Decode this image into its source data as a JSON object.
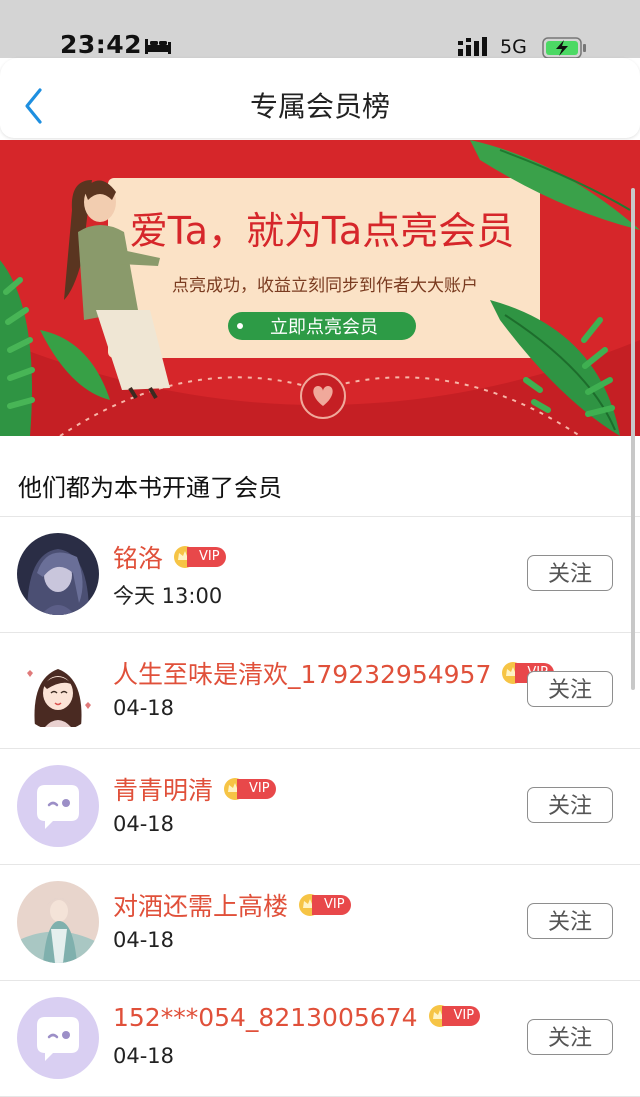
{
  "status_bar": {
    "time": "23:42",
    "network": "5G"
  },
  "header": {
    "title": "专属会员榜"
  },
  "banner": {
    "headline": "爱Ta，就为Ta点亮会员",
    "subline": "点亮成功，收益立刻同步到作者大大账户",
    "cta_label": "立即点亮会员"
  },
  "section": {
    "title": "他们都为本书开通了会员"
  },
  "vip_label": "VIP",
  "follow_label": "关注",
  "members": [
    {
      "name": "铭洛",
      "time": "今天 13:00",
      "avatar": "dark-girl-avatar"
    },
    {
      "name": "人生至味是清欢_179232954957",
      "time": "04-18",
      "avatar": "cartoon-girl-avatar"
    },
    {
      "name": "青青明清",
      "time": "04-18",
      "avatar": "default-chat-avatar"
    },
    {
      "name": "对酒还需上高楼",
      "time": "04-18",
      "avatar": "ancient-style-avatar"
    },
    {
      "name": "152***054_8213005674",
      "time": "04-18",
      "avatar": "default-chat-avatar"
    }
  ],
  "colors": {
    "accent": "#e0503a",
    "banner_red": "#d6262a",
    "vip_red": "#e8484a"
  }
}
